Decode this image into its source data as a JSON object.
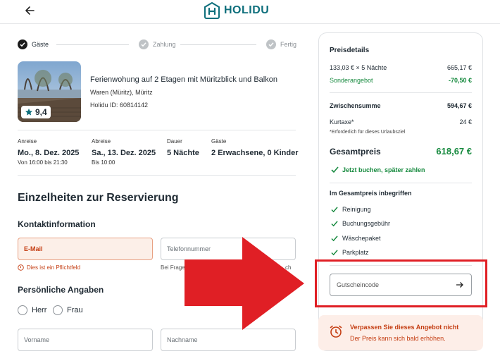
{
  "brand": {
    "name": "HOLIDU"
  },
  "steps": [
    {
      "label": "Gäste",
      "state": "active"
    },
    {
      "label": "Zahlung",
      "state": "inactive"
    },
    {
      "label": "Fertig",
      "state": "inactive"
    }
  ],
  "property": {
    "title": "Ferienwohung auf 2 Etagen mit Müritzblick und Balkon",
    "location": "Waren (Müritz), Müritz",
    "id_text": "Holidu ID: 60814142",
    "rating": "9,4"
  },
  "stay": {
    "arrival_label": "Anreise",
    "arrival_value": "Mo., 8. Dez. 2025",
    "arrival_sub": "Von 16:00 bis 21:30",
    "departure_label": "Abreise",
    "departure_value": "Sa., 13. Dez. 2025",
    "departure_sub": "Bis 10:00",
    "duration_label": "Dauer",
    "duration_value": "5 Nächte",
    "guests_label": "Gäste",
    "guests_value": "2 Erwachsene, 0 Kinder"
  },
  "form": {
    "heading": "Einzelheiten zur Reservierung",
    "contact_heading": "Kontaktinformation",
    "email_placeholder": "E-Mail",
    "phone_placeholder": "Telefonnummer",
    "email_error": "Dies ist ein Pflichtfeld",
    "phone_hint_start": "Bei Frage",
    "phone_hint_end": "ch",
    "personal_heading": "Persönliche Angaben",
    "salutation_mr": "Herr",
    "salutation_ms": "Frau",
    "firstname_placeholder": "Vorname",
    "lastname_placeholder": "Nachname"
  },
  "price": {
    "title": "Preisdetails",
    "nightly_label": "133,03 € × 5 Nächte",
    "nightly_value": "665,17 €",
    "special_label": "Sonderangebot",
    "special_value": "-70,50 €",
    "subtotal_label": "Zwischensumme",
    "subtotal_value": "594,67 €",
    "tax_label": "Kurtaxe*",
    "tax_value": "24 €",
    "tax_note": "*Erforderlich für dieses Urlaubsziel",
    "total_label": "Gesamtpreis",
    "total_value": "618,67 €",
    "pay_later": "Jetzt buchen, später zahlen",
    "included_title": "Im Gesamtpreis inbegriffen",
    "included": [
      "Reinigung",
      "Buchungsgebühr",
      "Wäschepaket",
      "Parkplatz"
    ],
    "voucher_placeholder": "Gutscheincode"
  },
  "alert": {
    "title": "Verpassen Sie dieses Angebot nicht",
    "subtitle": "Der Preis kann sich bald erhöhen."
  },
  "colors": {
    "brand": "#0e6f7c",
    "success": "#178a3f",
    "error": "#c43d12",
    "highlight": "#e01f25"
  }
}
